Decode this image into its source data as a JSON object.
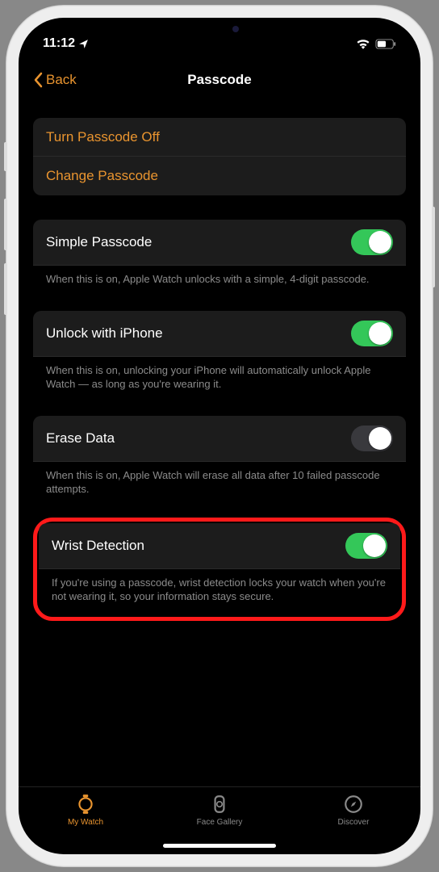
{
  "status": {
    "time": "11:12",
    "wifi": true,
    "battery": 50
  },
  "nav": {
    "back": "Back",
    "title": "Passcode"
  },
  "group1": {
    "item1": "Turn Passcode Off",
    "item2": "Change Passcode"
  },
  "simple": {
    "label": "Simple Passcode",
    "on": true,
    "footer": "When this is on, Apple Watch unlocks with a simple, 4-digit passcode."
  },
  "unlock": {
    "label": "Unlock with iPhone",
    "on": true,
    "footer": "When this is on, unlocking your iPhone will automatically unlock Apple Watch — as long as you're wearing it."
  },
  "erase": {
    "label": "Erase Data",
    "on": false,
    "footer": "When this is on, Apple Watch will erase all data after 10 failed passcode attempts."
  },
  "wrist": {
    "label": "Wrist Detection",
    "on": true,
    "footer": "If you're using a passcode, wrist detection locks your watch when you're not wearing it, so your information stays secure."
  },
  "tabs": {
    "watch": "My Watch",
    "gallery": "Face Gallery",
    "discover": "Discover"
  }
}
